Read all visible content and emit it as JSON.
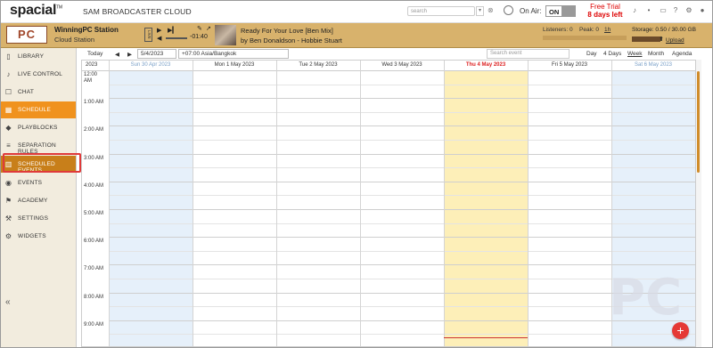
{
  "header": {
    "logo": "spacial",
    "logo_tm": "TM",
    "app_title": "SAM BROADCASTER CLOUD",
    "search_placeholder": "search",
    "search_btn": "▾",
    "search_clear": "⊗",
    "on_air_label": "On Air:",
    "on_air_toggle": "ON",
    "trial_line1": "Free Trial",
    "trial_line2": "8 days left"
  },
  "player": {
    "station_logo": "PC",
    "station_name": "WinningPC Station",
    "station_sub": "Cloud Station",
    "live_badge": "LIVE",
    "time_remaining": "-01:40",
    "track_title": "Ready For Your Love [Ben Mix]",
    "track_artist": "by Ben Donaldson - Hobbie Stuart",
    "listeners": "Listeners: 0",
    "peak": "Peak: 0",
    "peak_link": "1h",
    "storage": "Storage: 0.50 / 30.00 GB",
    "upload": "Upload"
  },
  "sidebar": {
    "items": [
      {
        "label": "LIBRARY",
        "icon": "library-icon",
        "glyph": "▯"
      },
      {
        "label": "LIVE CONTROL",
        "icon": "microphone-icon",
        "glyph": "♪"
      },
      {
        "label": "CHAT",
        "icon": "chat-icon",
        "glyph": "☐"
      },
      {
        "label": "SCHEDULE",
        "icon": "calendar-icon",
        "glyph": "▦"
      },
      {
        "label": "PLAYBLOCKS",
        "icon": "playblocks-icon",
        "glyph": "◆"
      },
      {
        "label": "SEPARATION RULES",
        "icon": "separation-icon",
        "glyph": "≡"
      },
      {
        "label": "SCHEDULED EVENTS",
        "icon": "trash-icon",
        "glyph": "▥"
      },
      {
        "label": "EVENTS",
        "icon": "events-icon",
        "glyph": "◉"
      },
      {
        "label": "ACADEMY",
        "icon": "academy-icon",
        "glyph": "⚑"
      },
      {
        "label": "SETTINGS",
        "icon": "wrench-icon",
        "glyph": "⚒"
      },
      {
        "label": "WIDGETS",
        "icon": "widgets-icon",
        "glyph": "⚙"
      }
    ],
    "collapse": "«"
  },
  "toolbar": {
    "today": "Today",
    "prev": "◀",
    "next": "▶",
    "date_value": "5/4/2023",
    "timezone": "+07:00 Asia/Bangkok",
    "search_placeholder": "Search event",
    "views": [
      "Day",
      "4 Days",
      "Week",
      "Month",
      "Agenda"
    ]
  },
  "calendar": {
    "year": "2023",
    "days": [
      {
        "label": "Sun 30 Apr 2023",
        "kind": "weekend"
      },
      {
        "label": "Mon 1 May 2023",
        "kind": "normal"
      },
      {
        "label": "Tue 2 May 2023",
        "kind": "normal"
      },
      {
        "label": "Wed 3 May 2023",
        "kind": "normal"
      },
      {
        "label": "Thu 4 May 2023",
        "kind": "today"
      },
      {
        "label": "Fri 5 May 2023",
        "kind": "normal"
      },
      {
        "label": "Sat 6 May 2023",
        "kind": "weekend"
      }
    ],
    "times": [
      "12:00 AM",
      "1:00 AM",
      "2:00 AM",
      "3:00 AM",
      "4:00 AM",
      "5:00 AM",
      "6:00 AM",
      "7:00 AM",
      "8:00 AM",
      "9:00 AM"
    ]
  },
  "fab": "+",
  "watermark": "PC",
  "colors": {
    "accent": "#f0921e",
    "player_bg": "#d8b26c",
    "today_col": "#fdefb8",
    "weekend_col": "#e6f0fa",
    "highlight_box": "#e03a3a"
  }
}
